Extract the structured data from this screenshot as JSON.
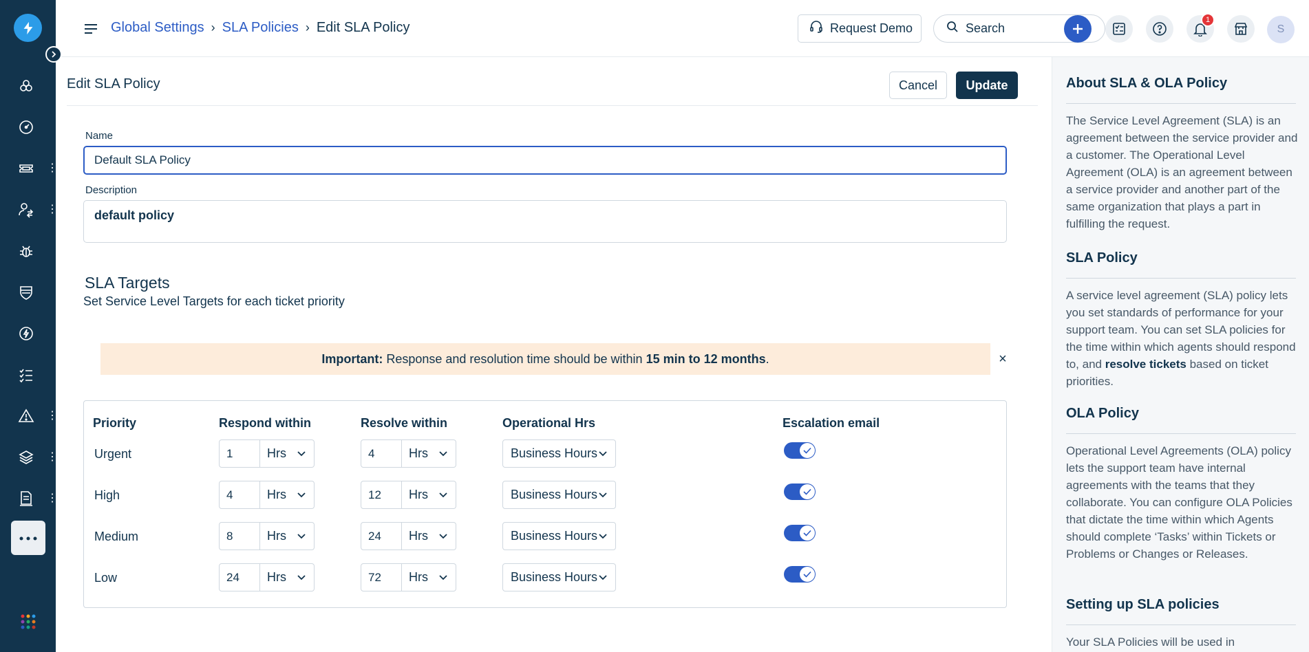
{
  "header": {
    "breadcrumb": {
      "item1": "Global Settings",
      "item2": "SLA Policies",
      "current": "Edit SLA Policy",
      "separator": "›"
    },
    "request_demo_label": "Request Demo",
    "search_placeholder": "Search",
    "notification_count": "1",
    "avatar_initial": "S"
  },
  "page": {
    "title": "Edit SLA Policy",
    "cancel_label": "Cancel",
    "update_label": "Update"
  },
  "form": {
    "name_label": "Name",
    "name_value": "Default SLA Policy",
    "description_label": "Description",
    "description_value": "default policy"
  },
  "sla_targets": {
    "title": "SLA Targets",
    "subtitle": "Set Service Level Targets for each ticket priority",
    "alert": {
      "prefix": "Important:",
      "text": " Response and resolution time should be within ",
      "range": "15 min to 12 months",
      "suffix": ".",
      "close": "×"
    },
    "columns": {
      "priority": "Priority",
      "respond": "Respond within",
      "resolve": "Resolve within",
      "operational": "Operational Hrs",
      "escalation": "Escalation email"
    },
    "rows": [
      {
        "priority": "Urgent",
        "respond_value": "1",
        "respond_unit": "Hrs",
        "resolve_value": "4",
        "resolve_unit": "Hrs",
        "operational": "Business Hours",
        "escalation": true
      },
      {
        "priority": "High",
        "respond_value": "4",
        "respond_unit": "Hrs",
        "resolve_value": "12",
        "resolve_unit": "Hrs",
        "operational": "Business Hours",
        "escalation": true
      },
      {
        "priority": "Medium",
        "respond_value": "8",
        "respond_unit": "Hrs",
        "resolve_value": "24",
        "resolve_unit": "Hrs",
        "operational": "Business Hours",
        "escalation": true
      },
      {
        "priority": "Low",
        "respond_value": "24",
        "respond_unit": "Hrs",
        "resolve_value": "72",
        "resolve_unit": "Hrs",
        "operational": "Business Hours",
        "escalation": true
      }
    ]
  },
  "help_panel": {
    "about_title": "About SLA & OLA Policy",
    "about_text": "The Service Level Agreement (SLA) is an agreement between the service provider and a customer. The Operational Level Agreement (OLA) is an agreement between a service provider and another part of the same organization that plays a part in fulfilling the request.",
    "sla_title": "SLA Policy",
    "sla_text_1": "A service level agreement (SLA) policy lets you set standards of performance for your support team. You can set SLA policies for the time within which agents should respond to, and ",
    "sla_text_bold": "resolve tickets",
    "sla_text_2": " based on ticket priorities.",
    "ola_title": "OLA Policy",
    "ola_text": "Operational Level Agreements (OLA) policy lets the support team have internal agreements with the teams that they collaborate. You can configure OLA Policies that dictate the time within which Agents should complete ‘Tasks’ within Tickets or Problems or Changes or Releases.",
    "setup_title": "Setting up SLA policies",
    "setup_text": "Your SLA Policies will be used in"
  },
  "sidebar": {
    "items": [
      {
        "icon": "apps-cluster-icon",
        "has_more": false
      },
      {
        "icon": "dashboard-gauge-icon",
        "has_more": false
      },
      {
        "icon": "ticket-icon",
        "has_more": true
      },
      {
        "icon": "user-switch-icon",
        "has_more": true
      },
      {
        "icon": "bug-icon",
        "has_more": false
      },
      {
        "icon": "shield-icon",
        "has_more": false
      },
      {
        "icon": "bolt-icon",
        "has_more": false
      },
      {
        "icon": "checklist-icon",
        "has_more": false
      },
      {
        "icon": "alert-triangle-icon",
        "has_more": true
      },
      {
        "icon": "layers-icon",
        "has_more": true
      },
      {
        "icon": "document-icon",
        "has_more": true
      }
    ],
    "more_icon": "more-dots-icon",
    "apps_icon": "apps-grid-icon"
  },
  "colors": {
    "sidebar_bg": "#12344d",
    "primary": "#2c5cc5",
    "logo": "#2c9ce8",
    "alert_bg": "#fdecdb",
    "badge": "#e43538"
  }
}
